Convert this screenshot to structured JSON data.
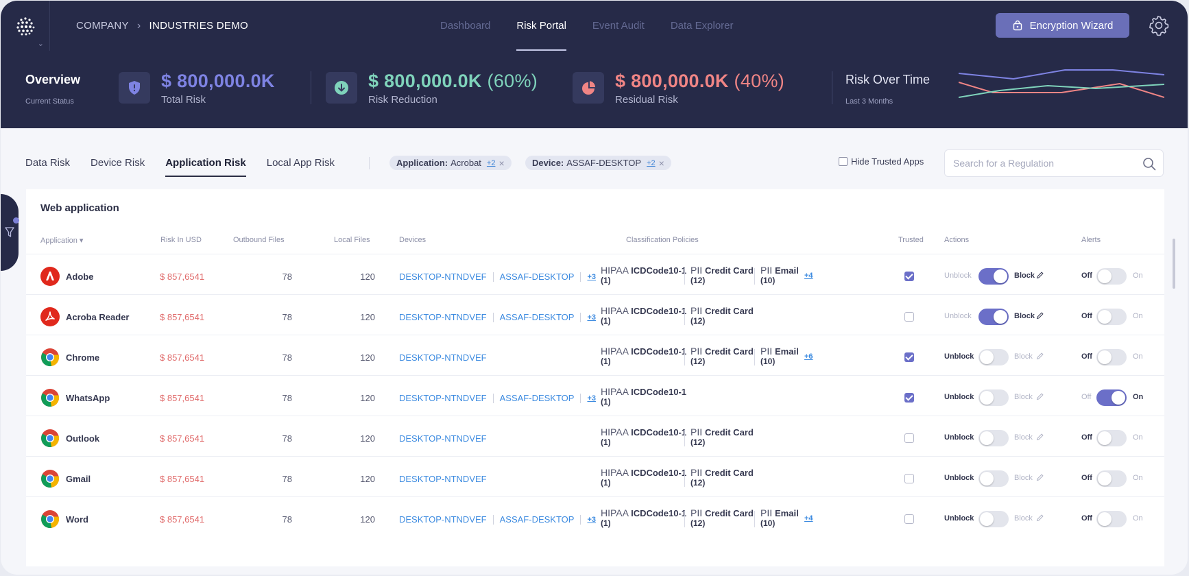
{
  "breadcrumb": {
    "company": "COMPANY",
    "current": "INDUSTRIES DEMO"
  },
  "nav": {
    "tabs": [
      "Dashboard",
      "Risk Portal",
      "Event Audit",
      "Data Explorer"
    ],
    "active": "Risk Portal"
  },
  "encryption_button": "Encryption Wizard",
  "overview": {
    "title": "Overview",
    "subtitle": "Current Status",
    "metrics": [
      {
        "value": "$ 800,000.0K",
        "percent": "",
        "label": "Total Risk",
        "color": "#7e83e3",
        "icon": "shield-alert-icon"
      },
      {
        "value": "$ 800,000.0K",
        "percent": "(60%)",
        "label": "Risk Reduction",
        "color": "#7fd3bb",
        "icon": "arrow-down-circle-icon"
      },
      {
        "value": "$ 800,000.0K",
        "percent": "(40%)",
        "label": "Residual Risk",
        "color": "#f08585",
        "icon": "pie-chart-icon"
      }
    ],
    "risk_over_time": {
      "title": "Risk Over Time",
      "subtitle": "Last 3 Months"
    }
  },
  "subtabs": [
    "Data Risk",
    "Device Risk",
    "Application Risk",
    "Local App Risk"
  ],
  "active_subtab": "Application Risk",
  "filters": [
    {
      "key": "Application:",
      "value": "Acrobat",
      "more": "+2"
    },
    {
      "key": "Device:",
      "value": "ASSAF-DESKTOP",
      "more": "+2"
    }
  ],
  "hide_trusted_label": "Hide Trusted Apps",
  "search_placeholder": "Search for a Regulation",
  "table": {
    "title": "Web application",
    "headers": {
      "application": "Application",
      "risk": "Risk In USD",
      "outbound": "Outbound Files",
      "local": "Local Files",
      "devices": "Devices",
      "policies": "Classification Policies",
      "trusted": "Trusted",
      "actions": "Actions",
      "alerts": "Alerts"
    },
    "labels": {
      "unblock": "Unblock",
      "block": "Block",
      "off": "Off",
      "on": "On"
    },
    "policy_labels": {
      "hipaa_prefix": "HIPAA",
      "hipaa_name": "ICDCode10-1",
      "hipaa_count": "(1)",
      "pii_cc_prefix": "PII",
      "pii_cc_name": "Credit Card",
      "pii_cc_count": "(12)",
      "pii_email_prefix": "PII",
      "pii_email_name": "Email",
      "pii_email_count": "(10)"
    },
    "rows": [
      {
        "name": "Adobe",
        "icon": "adobe",
        "risk": "$ 857,6541",
        "outbound": "78",
        "local": "120",
        "devices": [
          "DESKTOP-NTNDVEF",
          "ASSAF-DESKTOP"
        ],
        "devices_more": "+3",
        "policies": 3,
        "policies_more": "+4",
        "trusted": true,
        "blocked": true,
        "alert_on": false
      },
      {
        "name": "Acroba Reader",
        "icon": "acrobat",
        "risk": "$ 857,6541",
        "outbound": "78",
        "local": "120",
        "devices": [
          "DESKTOP-NTNDVEF",
          "ASSAF-DESKTOP"
        ],
        "devices_more": "+3",
        "policies": 2,
        "policies_more": "",
        "trusted": false,
        "blocked": true,
        "alert_on": false
      },
      {
        "name": "Chrome",
        "icon": "chrome",
        "risk": "$ 857,6541",
        "outbound": "78",
        "local": "120",
        "devices": [
          "DESKTOP-NTNDVEF"
        ],
        "devices_more": "",
        "policies": 3,
        "policies_more": "+6",
        "trusted": true,
        "blocked": false,
        "alert_on": false
      },
      {
        "name": "WhatsApp",
        "icon": "chrome",
        "risk": "$ 857,6541",
        "outbound": "78",
        "local": "120",
        "devices": [
          "DESKTOP-NTNDVEF",
          "ASSAF-DESKTOP"
        ],
        "devices_more": "+3",
        "policies": 1,
        "policies_more": "",
        "trusted": true,
        "blocked": false,
        "alert_on": true
      },
      {
        "name": "Outlook",
        "icon": "chrome",
        "risk": "$ 857,6541",
        "outbound": "78",
        "local": "120",
        "devices": [
          "DESKTOP-NTNDVEF"
        ],
        "devices_more": "",
        "policies": 2,
        "policies_more": "",
        "trusted": false,
        "blocked": false,
        "alert_on": false
      },
      {
        "name": "Gmail",
        "icon": "chrome",
        "risk": "$ 857,6541",
        "outbound": "78",
        "local": "120",
        "devices": [
          "DESKTOP-NTNDVEF"
        ],
        "devices_more": "",
        "policies": 2,
        "policies_more": "",
        "trusted": false,
        "blocked": false,
        "alert_on": false
      },
      {
        "name": "Word",
        "icon": "chrome",
        "risk": "$ 857,6541",
        "outbound": "78",
        "local": "120",
        "devices": [
          "DESKTOP-NTNDVEF",
          "ASSAF-DESKTOP"
        ],
        "devices_more": "+3",
        "policies": 3,
        "policies_more": "+4",
        "trusted": false,
        "blocked": false,
        "alert_on": false
      }
    ]
  }
}
